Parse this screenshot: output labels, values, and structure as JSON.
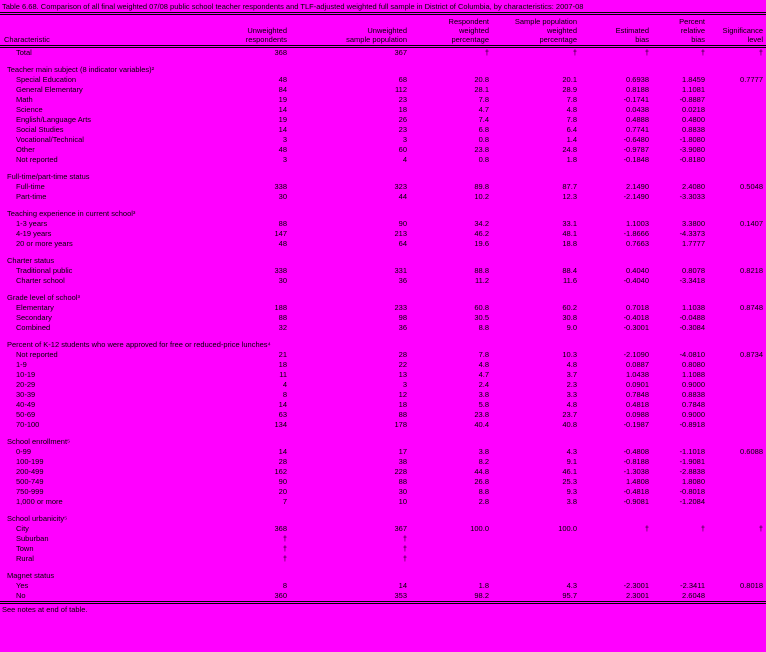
{
  "page": {
    "background": "#ff00ff",
    "text_color": "#000000",
    "title": "Table 6.68. Comparison of all final weighted 07/08 public school teacher respondents and TLF-adjusted weighted full sample in District of Columbia, by characteristics: 2007-08",
    "footer": "See notes at end of table."
  },
  "table": {
    "columns": [
      "Characteristic",
      "Unweighted\nrespondents",
      "Unweighted\nsample population",
      "Respondent\nweighted\npercentage",
      "Sample population\nweighted\npercentage",
      "Estimated\nbias",
      "Percent\nrelative\nbias",
      "Significance\nlevel"
    ],
    "total_row": [
      "Total",
      "368",
      "367",
      "†",
      "†",
      "†",
      "†",
      "†"
    ],
    "sections": [
      {
        "label": "Teacher main subject (8 indicator variables)²",
        "rows": [
          [
            "Special Education",
            "48",
            "68",
            "20.8",
            "20.1",
            "0.6938",
            "1.8459",
            "0.7777"
          ],
          [
            "General Elementary",
            "84",
            "112",
            "28.1",
            "28.9",
            "0.8188",
            "1.1081",
            ""
          ],
          [
            "Math",
            "19",
            "23",
            "7.8",
            "7.8",
            "-0.1741",
            "-0.8887",
            ""
          ],
          [
            "Science",
            "14",
            "18",
            "4.7",
            "4.8",
            "0.0438",
            "0.0218",
            ""
          ],
          [
            "English/Language Arts",
            "19",
            "26",
            "7.4",
            "7.8",
            "0.4888",
            "0.4800",
            ""
          ],
          [
            "Social Studies",
            "14",
            "23",
            "6.8",
            "6.4",
            "0.7741",
            "0.8838",
            ""
          ],
          [
            "Vocational/Technical",
            "3",
            "3",
            "0.8",
            "1.4",
            "-0.6480",
            "-1.8080",
            ""
          ],
          [
            "Other",
            "48",
            "60",
            "23.8",
            "24.8",
            "-0.9787",
            "-3.9080",
            ""
          ],
          [
            "Not reported",
            "3",
            "4",
            "0.8",
            "1.8",
            "-0.1848",
            "-0.8180",
            ""
          ]
        ]
      },
      {
        "label": "Full-time/part-time status",
        "rows": [
          [
            "Full-time",
            "338",
            "323",
            "89.8",
            "87.7",
            "2.1490",
            "2.4080",
            "0.5048"
          ],
          [
            "Part-time",
            "30",
            "44",
            "10.2",
            "12.3",
            "-2.1490",
            "-3.3033",
            ""
          ]
        ]
      },
      {
        "label": "Teaching experience in current school³",
        "rows": [
          [
            "1-3 years",
            "88",
            "90",
            "34.2",
            "33.1",
            "1.1003",
            "3.3800",
            "0.1407"
          ],
          [
            "4-19 years",
            "147",
            "213",
            "46.2",
            "48.1",
            "-1.8666",
            "-4.3373",
            ""
          ],
          [
            "20 or more years",
            "48",
            "64",
            "19.6",
            "18.8",
            "0.7663",
            "1.7777",
            ""
          ]
        ]
      },
      {
        "label": "Charter status",
        "rows": [
          [
            "Traditional public",
            "338",
            "331",
            "88.8",
            "88.4",
            "0.4040",
            "0.8078",
            "0.8218"
          ],
          [
            "Charter school",
            "30",
            "36",
            "11.2",
            "11.6",
            "-0.4040",
            "-3.3418",
            ""
          ]
        ]
      },
      {
        "label": "Grade level of school³",
        "rows": [
          [
            "Elementary",
            "188",
            "233",
            "60.8",
            "60.2",
            "0.7018",
            "1.1038",
            "0.8748"
          ],
          [
            "Secondary",
            "88",
            "98",
            "30.5",
            "30.8",
            "-0.4018",
            "-0.0488",
            ""
          ],
          [
            "Combined",
            "32",
            "36",
            "8.8",
            "9.0",
            "-0.3001",
            "-0.3084",
            ""
          ]
        ]
      },
      {
        "label": "Percent of K-12 students who were approved for free or reduced-price lunches⁴",
        "rows": [
          [
            "Not reported",
            "21",
            "28",
            "7.8",
            "10.3",
            "-2.1090",
            "-4.0810",
            "0.8734"
          ],
          [
            "1-9",
            "18",
            "22",
            "4.8",
            "4.8",
            "0.0887",
            "0.8080",
            ""
          ],
          [
            "10-19",
            "11",
            "13",
            "4.7",
            "3.7",
            "1.0438",
            "1.1088",
            ""
          ],
          [
            "20-29",
            "4",
            "3",
            "2.4",
            "2.3",
            "0.0901",
            "0.9000",
            ""
          ],
          [
            "30-39",
            "8",
            "12",
            "3.8",
            "3.3",
            "0.7848",
            "0.8838",
            ""
          ],
          [
            "40-49",
            "14",
            "18",
            "5.8",
            "4.8",
            "0.4818",
            "0.7848",
            ""
          ],
          [
            "50-69",
            "63",
            "88",
            "23.8",
            "23.7",
            "0.0988",
            "0.9000",
            ""
          ],
          [
            "70-100",
            "134",
            "178",
            "40.4",
            "40.8",
            "-0.1987",
            "-0.8918",
            ""
          ]
        ]
      },
      {
        "label": "School enrollment⁵",
        "rows": [
          [
            "0-99",
            "14",
            "17",
            "3.8",
            "4.3",
            "-0.4808",
            "-1.1018",
            "0.6088"
          ],
          [
            "100-199",
            "28",
            "38",
            "8.2",
            "9.1",
            "-0.8188",
            "-1.9081",
            ""
          ],
          [
            "200-499",
            "162",
            "228",
            "44.8",
            "46.1",
            "-1.3038",
            "-2.8838",
            ""
          ],
          [
            "500-749",
            "90",
            "88",
            "26.8",
            "25.3",
            "1.4808",
            "1.8080",
            ""
          ],
          [
            "750-999",
            "20",
            "30",
            "8.8",
            "9.3",
            "-0.4818",
            "-0.8018",
            ""
          ],
          [
            "1,000 or more",
            "7",
            "10",
            "2.8",
            "3.8",
            "-0.9081",
            "-1.2084",
            ""
          ]
        ]
      },
      {
        "label": "School urbanicity⁵",
        "rows": [
          [
            "City",
            "368",
            "367",
            "100.0",
            "100.0",
            "†",
            "†",
            "†"
          ],
          [
            "Suburban",
            "†",
            "†",
            "",
            "",
            "",
            "",
            ""
          ],
          [
            "Town",
            "†",
            "†",
            "",
            "",
            "",
            "",
            ""
          ],
          [
            "Rural",
            "†",
            "†",
            "",
            "",
            "",
            "",
            ""
          ]
        ]
      },
      {
        "label": "Magnet status",
        "rows": [
          [
            "Yes",
            "8",
            "14",
            "1.8",
            "4.3",
            "-2.3001",
            "-2.3411",
            "0.8018"
          ],
          [
            "No",
            "360",
            "353",
            "98.2",
            "95.7",
            "2.3001",
            "2.6048",
            ""
          ]
        ]
      }
    ]
  }
}
